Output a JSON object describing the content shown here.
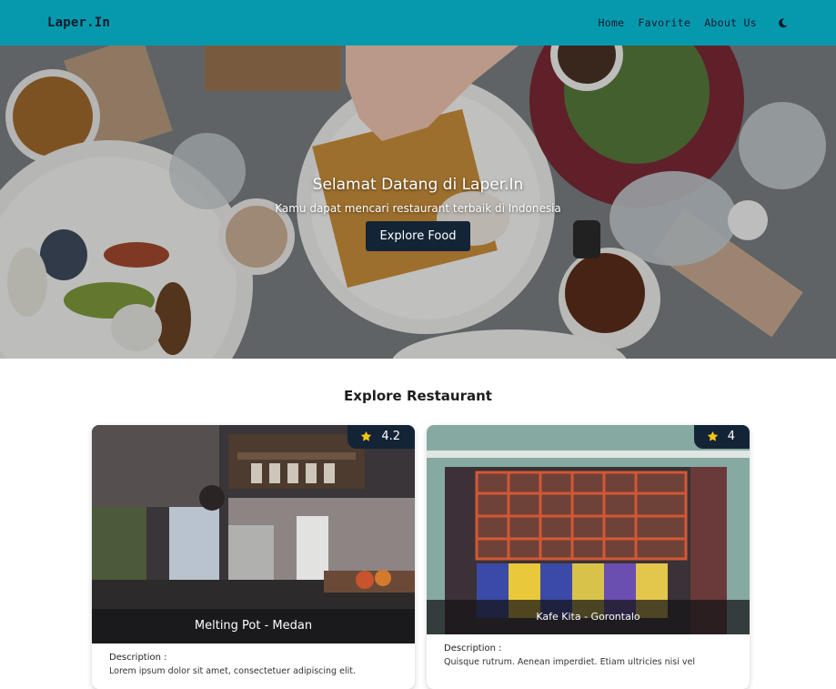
{
  "header": {
    "brand": "Laper.In",
    "nav": [
      "Home",
      "Favorite",
      "About Us"
    ],
    "theme_toggle_icon": "moon-icon",
    "background": "#0699ae"
  },
  "hero": {
    "title": "Selamat Datang di Laper.In",
    "subtitle": "Kamu dapat mencari restaurant terbaik di Indonesia",
    "button_label": "Explore Food"
  },
  "restaurants": {
    "section_title": "Explore Restaurant",
    "items": [
      {
        "name": "Melting Pot - Medan",
        "rating": "4.2",
        "description_label": "Description :",
        "description": "Lorem ipsum dolor sit amet, consectetuer adipiscing elit."
      },
      {
        "name": "Kafe Kita - Gorontalo",
        "rating": "4",
        "description_label": "Description :",
        "description": "Quisque rutrum. Aenean imperdiet. Etiam ultricies nisi vel"
      }
    ],
    "rating_icon": "star-icon",
    "accent": "#142437",
    "star_color": "#f5c518"
  }
}
